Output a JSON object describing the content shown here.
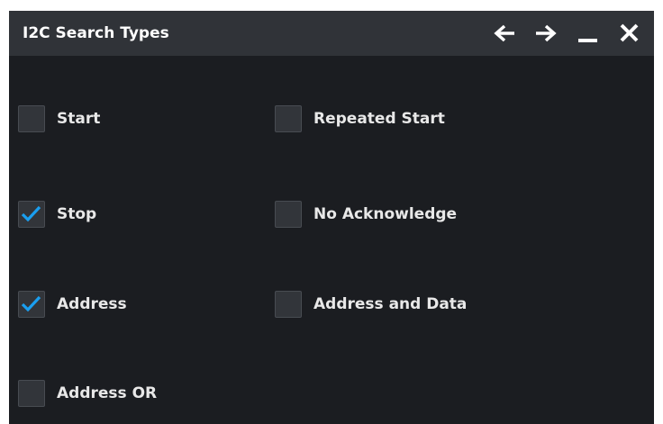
{
  "dialog": {
    "title": "I2C Search Types",
    "icons": [
      "arrow-left-icon",
      "arrow-right-icon",
      "minimize-icon",
      "close-icon"
    ]
  },
  "colors": {
    "background": "#1b1d21",
    "titlebar": "#303338",
    "checkbox": "#32353a",
    "checkmark": "#1a9ff0",
    "text": "#e8e8e8"
  },
  "options": [
    {
      "label": "Start",
      "checked": false
    },
    {
      "label": "Repeated Start",
      "checked": false
    },
    {
      "label": "Stop",
      "checked": true
    },
    {
      "label": "No Acknowledge",
      "checked": false
    },
    {
      "label": "Address",
      "checked": true
    },
    {
      "label": "Address and Data",
      "checked": false
    },
    {
      "label": "Address OR",
      "checked": false
    }
  ]
}
